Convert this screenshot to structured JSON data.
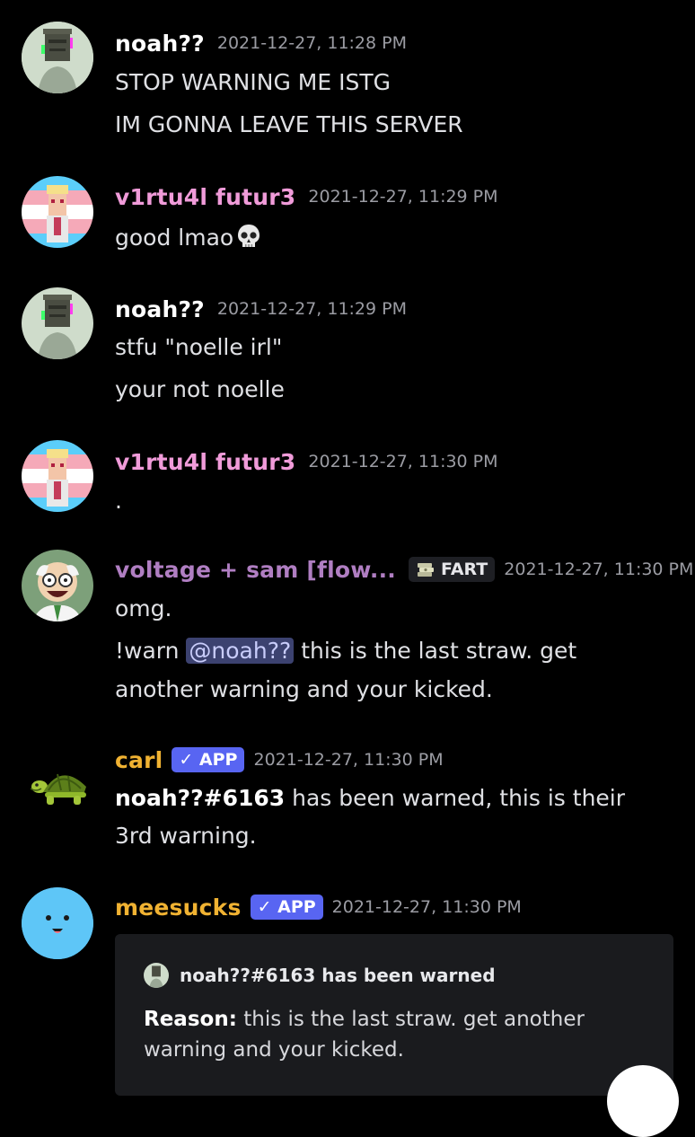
{
  "colors": {
    "background": "#000000",
    "noah_name": "#ffffff",
    "virtual_name": "#f09bd9",
    "voltage_name": "#b07ec2",
    "carl_name": "#f0b232",
    "meesucks_name": "#f0b232",
    "app_badge": "#5865f2"
  },
  "messages": [
    {
      "author": "noah??",
      "timestamp": "2021-12-27, 11:28 PM",
      "avatar": "noah-avatar",
      "lines": [
        "STOP WARNING ME ISTG",
        "IM GONNA LEAVE THIS SERVER"
      ]
    },
    {
      "author": "v1rtu4l futur3",
      "timestamp": "2021-12-27, 11:29 PM",
      "avatar": "trans-flag-avatar",
      "lines": [
        "good lmao"
      ],
      "emoji": "skull-emoji"
    },
    {
      "author": "noah??",
      "timestamp": "2021-12-27, 11:29 PM",
      "avatar": "noah-avatar",
      "lines": [
        "stfu \"noelle irl\"",
        "your not noelle"
      ]
    },
    {
      "author": "v1rtu4l futur3",
      "timestamp": "2021-12-27, 11:30 PM",
      "avatar": "trans-flag-avatar",
      "lines": [
        "."
      ]
    },
    {
      "author": "voltage + sam [flow...",
      "badge": "FART",
      "badge_icon": "money-icon",
      "timestamp": "2021-12-27, 11:30 PM",
      "avatar": "professor-avatar",
      "lines": [
        "omg."
      ],
      "warn_prefix": "!warn ",
      "mention": "@noah??",
      "warn_rest": " this is the last straw. get",
      "warn_line2": "another warning and your kicked."
    },
    {
      "author": "carl",
      "badge": "✓ APP",
      "timestamp": "2021-12-27, 11:30 PM",
      "avatar": "turtle-avatar",
      "bold_part": "noah??#6163",
      "rest_line1": " has been warned, this is their",
      "line2": "3rd warning."
    },
    {
      "author": "meesucks",
      "badge": "✓ APP",
      "timestamp": "2021-12-27, 11:30 PM",
      "avatar": "smiley-avatar",
      "embed": {
        "author": "noah??#6163 has been warned",
        "reason_label": "Reason:",
        "reason_text1": " this is the last straw. get another",
        "reason_text2": "warning and your kicked."
      }
    }
  ]
}
